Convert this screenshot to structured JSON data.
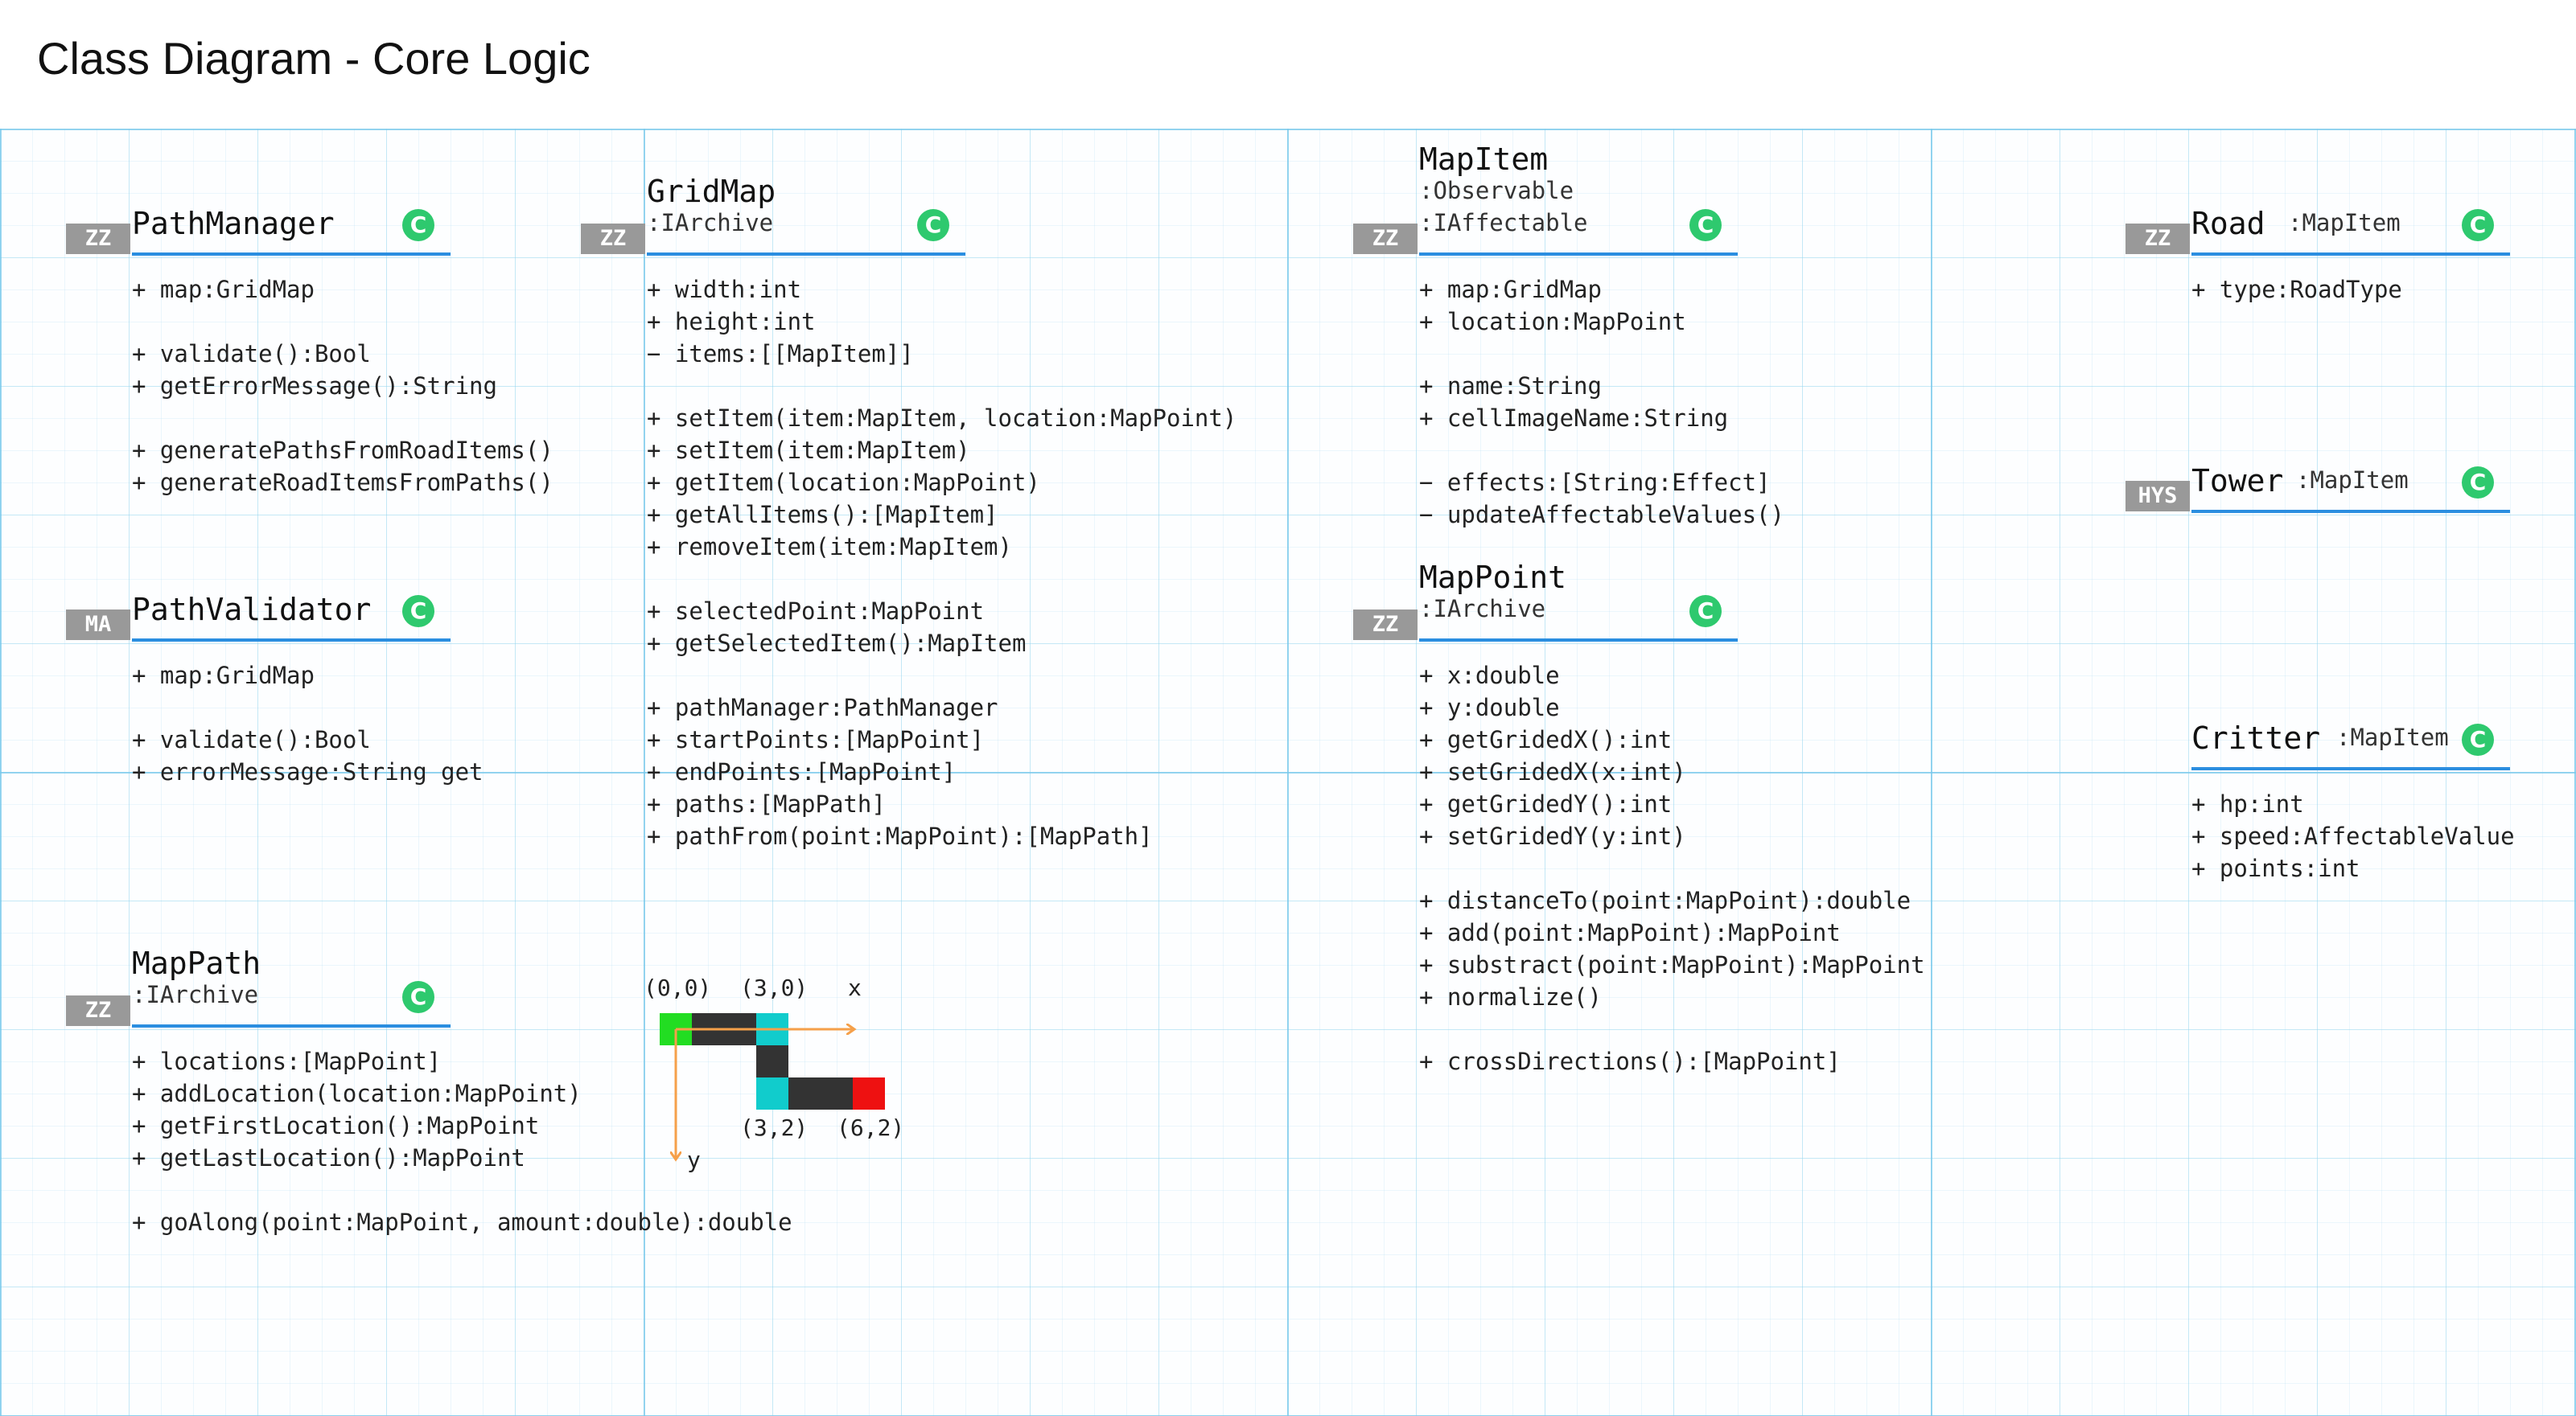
{
  "title": "Class Diagram - Core Logic",
  "classes": {
    "path_manager": {
      "tag": "ZZ",
      "name": "PathManager",
      "badge": "C",
      "members": [
        "+ map:GridMap",
        "",
        "+ validate():Bool",
        "+ getErrorMessage():String",
        "",
        "+ generatePathsFromRoadItems()",
        "+ generateRoadItemsFromPaths()"
      ]
    },
    "path_validator": {
      "tag": "MA",
      "name": "PathValidator",
      "badge": "C",
      "members": [
        "+ map:GridMap",
        "",
        "+ validate():Bool",
        "+ errorMessage:String get"
      ]
    },
    "map_path": {
      "tag": "ZZ",
      "name": "MapPath",
      "super": ":IArchive",
      "badge": "C",
      "members": [
        "+ locations:[MapPoint]",
        "+ addLocation(location:MapPoint)",
        "+ getFirstLocation():MapPoint",
        "+ getLastLocation():MapPoint",
        "",
        "+ goAlong(point:MapPoint, amount:double):double"
      ]
    },
    "grid_map": {
      "tag": "ZZ",
      "name": "GridMap",
      "super": ":IArchive",
      "badge": "C",
      "members": [
        "+ width:int",
        "+ height:int",
        "− items:[[MapItem]]",
        "",
        "+ setItem(item:MapItem, location:MapPoint)",
        "+ setItem(item:MapItem)",
        "+ getItem(location:MapPoint)",
        "+ getAllItems():[MapItem]",
        "+ removeItem(item:MapItem)",
        "",
        "+ selectedPoint:MapPoint",
        "+ getSelectedItem():MapItem",
        "",
        "+ pathManager:PathManager",
        "+ startPoints:[MapPoint]",
        "+ endPoints:[MapPoint]",
        "+ paths:[MapPath]",
        "+ pathFrom(point:MapPoint):[MapPath]"
      ]
    },
    "map_item": {
      "tag": "ZZ",
      "name": "MapItem",
      "super1": ":Observable",
      "super2": ":IAffectable",
      "badge": "C",
      "members": [
        "+ map:GridMap",
        "+ location:MapPoint",
        "",
        "+ name:String",
        "+ cellImageName:String",
        "",
        "− effects:[String:Effect]",
        "− updateAffectableValues()"
      ]
    },
    "map_point": {
      "tag": "ZZ",
      "name": "MapPoint",
      "super": ":IArchive",
      "badge": "C",
      "members": [
        "+ x:double",
        "+ y:double",
        "+ getGridedX():int",
        "+ setGridedX(x:int)",
        "+ getGridedY():int",
        "+ setGridedY(y:int)",
        "",
        "+ distanceTo(point:MapPoint):double",
        "+ add(point:MapPoint):MapPoint",
        "+ substract(point:MapPoint):MapPoint",
        "+ normalize()",
        "",
        "+ crossDirections():[MapPoint]"
      ]
    },
    "road": {
      "tag": "ZZ",
      "name": "Road",
      "super": ":MapItem",
      "badge": "C",
      "members": [
        "+ type:RoadType"
      ]
    },
    "tower": {
      "tag": "HYS",
      "name": "Tower",
      "super": ":MapItem",
      "badge": "C",
      "members": []
    },
    "critter": {
      "name": "Critter",
      "super": ":MapItem",
      "badge": "C",
      "members": [
        "+ hp:int",
        "+ speed:AffectableValue",
        "+ points:int"
      ]
    }
  },
  "path_figure": {
    "labels": {
      "origin": "(0,0)",
      "p30": "(3,0)",
      "x_axis": "x",
      "p32": "(3,2)",
      "p62": "(6,2)",
      "y_axis": "y"
    },
    "colors": {
      "start": "#22dd22",
      "corner": "#11cccc",
      "end": "#ee1111",
      "road": "#333333",
      "arrow": "#f5a04a"
    }
  }
}
